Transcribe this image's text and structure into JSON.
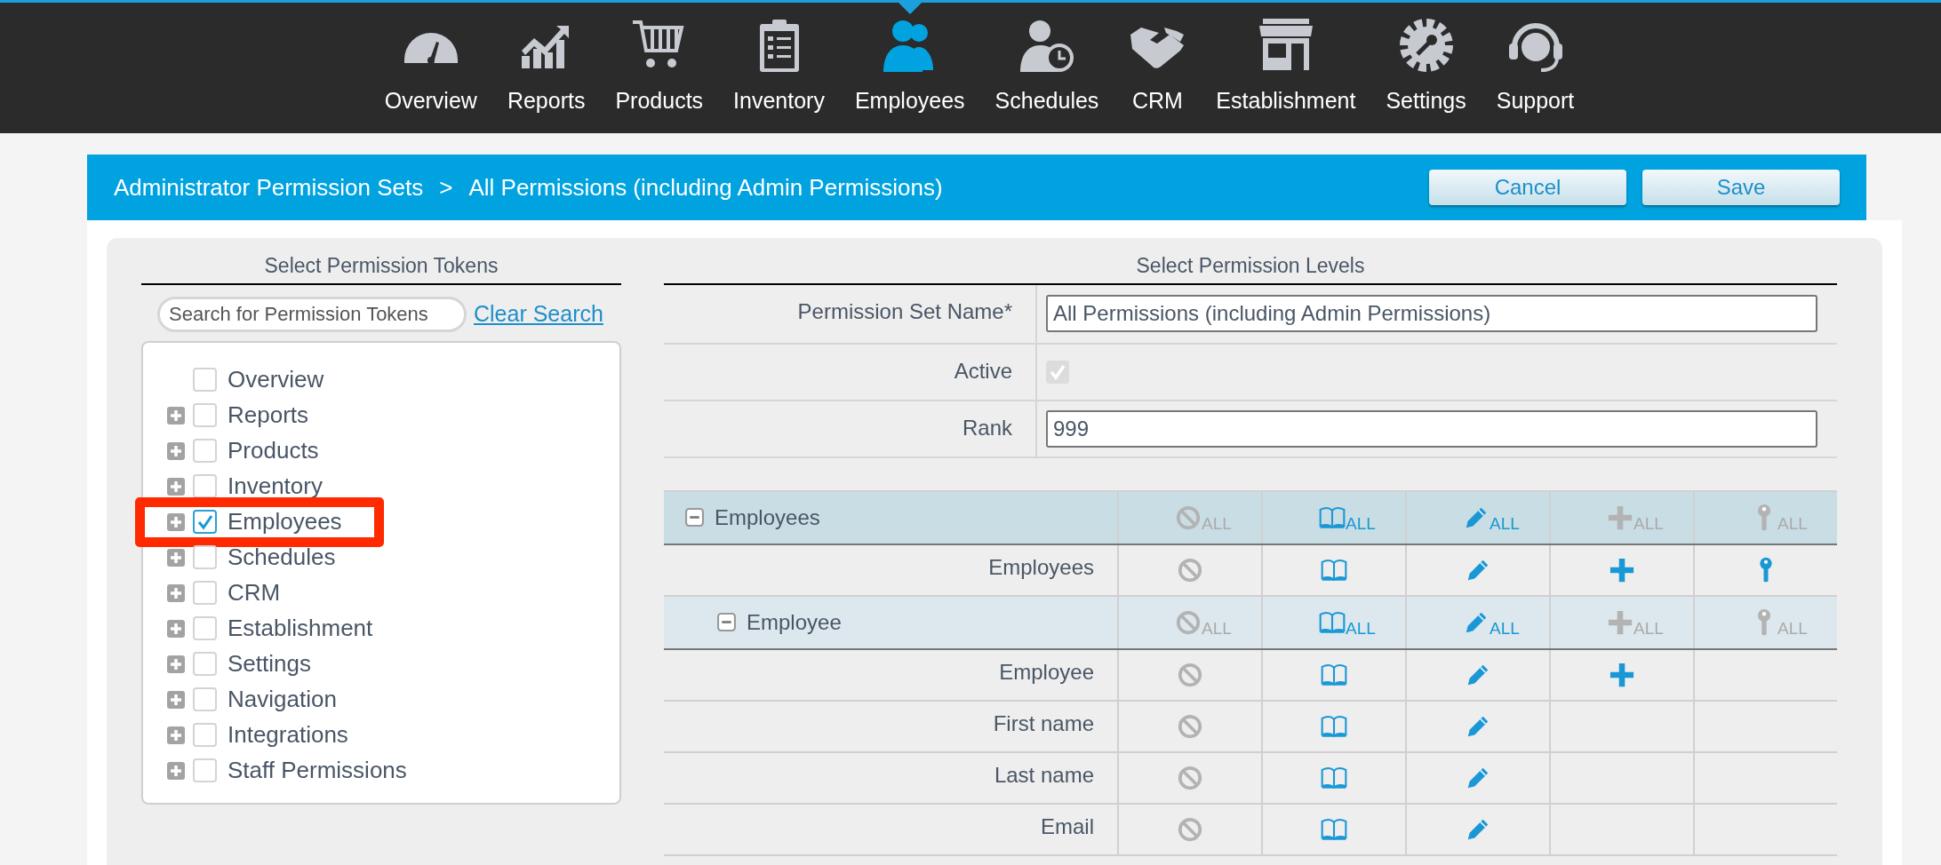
{
  "nav": [
    {
      "label": "Overview",
      "selected": false
    },
    {
      "label": "Reports",
      "selected": false
    },
    {
      "label": "Products",
      "selected": false
    },
    {
      "label": "Inventory",
      "selected": false
    },
    {
      "label": "Employees",
      "selected": true
    },
    {
      "label": "Schedules",
      "selected": false
    },
    {
      "label": "CRM",
      "selected": false
    },
    {
      "label": "Establishment",
      "selected": false
    },
    {
      "label": "Settings",
      "selected": false
    },
    {
      "label": "Support",
      "selected": false
    }
  ],
  "header": {
    "breadcrumb": [
      "Administrator Permission Sets",
      "All Permissions (including Admin Permissions)"
    ],
    "separator": ">",
    "buttons": [
      "Cancel",
      "Save"
    ]
  },
  "tokens": {
    "heading": "Select Permission Tokens",
    "search": {
      "placeholder": "Search for Permission Tokens"
    },
    "clear_link": "Clear Search",
    "tree": [
      {
        "label": "Overview",
        "checked": false,
        "expandable": false
      },
      {
        "label": "Reports",
        "checked": false,
        "expandable": true
      },
      {
        "label": "Products",
        "checked": false,
        "expandable": true
      },
      {
        "label": "Inventory",
        "checked": false,
        "expandable": true
      },
      {
        "label": "Employees",
        "checked": true,
        "expandable": true,
        "highlighted": true
      },
      {
        "label": "Schedules",
        "checked": false,
        "expandable": true
      },
      {
        "label": "CRM",
        "checked": false,
        "expandable": true
      },
      {
        "label": "Establishment",
        "checked": false,
        "expandable": true
      },
      {
        "label": "Settings",
        "checked": false,
        "expandable": true
      },
      {
        "label": "Navigation",
        "checked": false,
        "expandable": true
      },
      {
        "label": "Integrations",
        "checked": false,
        "expandable": true
      },
      {
        "label": "Staff Permissions",
        "checked": false,
        "expandable": true
      }
    ]
  },
  "levels": {
    "heading": "Select Permission Levels",
    "fields": [
      {
        "label": "Permission Set Name*",
        "kind": "text",
        "value": "All Permissions (including Admin Permissions)"
      },
      {
        "label": "Active",
        "kind": "checkbox",
        "checked": true,
        "disabled": true
      },
      {
        "label": "Rank",
        "kind": "text",
        "value": "999"
      }
    ],
    "table": [
      {
        "kind": "group",
        "label": "Employees",
        "expanded": true,
        "perms": [
          {
            "kind": "none",
            "label": "ALL",
            "active": false
          },
          {
            "kind": "read",
            "label": "ALL",
            "active": true
          },
          {
            "kind": "edit",
            "label": "ALL",
            "active": true
          },
          {
            "kind": "add",
            "label": "ALL",
            "active": false
          },
          {
            "kind": "key",
            "label": "ALL",
            "active": false
          }
        ],
        "children": [
          {
            "kind": "row",
            "label": "Employees",
            "perms": [
              {
                "kind": "none",
                "active": false
              },
              {
                "kind": "read",
                "active": true
              },
              {
                "kind": "edit",
                "active": true
              },
              {
                "kind": "add",
                "active": true
              },
              {
                "kind": "key",
                "active": true
              }
            ]
          },
          {
            "kind": "group",
            "label": "Employee",
            "expanded": true,
            "perms": [
              {
                "kind": "none",
                "label": "ALL",
                "active": false
              },
              {
                "kind": "read",
                "label": "ALL",
                "active": true
              },
              {
                "kind": "edit",
                "label": "ALL",
                "active": true
              },
              {
                "kind": "add",
                "label": "ALL",
                "active": false
              },
              {
                "kind": "key",
                "label": "ALL",
                "active": false
              }
            ],
            "children": [
              {
                "kind": "row",
                "label": "Employee",
                "perms": [
                  {
                    "kind": "none",
                    "active": false
                  },
                  {
                    "kind": "read",
                    "active": true
                  },
                  {
                    "kind": "edit",
                    "active": true
                  },
                  {
                    "kind": "add",
                    "active": true
                  },
                  {
                    "kind": "blank"
                  }
                ]
              },
              {
                "kind": "row",
                "label": "First name",
                "perms": [
                  {
                    "kind": "none",
                    "active": false
                  },
                  {
                    "kind": "read",
                    "active": true
                  },
                  {
                    "kind": "edit",
                    "active": true
                  },
                  {
                    "kind": "blank"
                  },
                  {
                    "kind": "blank"
                  }
                ]
              },
              {
                "kind": "row",
                "label": "Last name",
                "perms": [
                  {
                    "kind": "none",
                    "active": false
                  },
                  {
                    "kind": "read",
                    "active": true
                  },
                  {
                    "kind": "edit",
                    "active": true
                  },
                  {
                    "kind": "blank"
                  },
                  {
                    "kind": "blank"
                  }
                ]
              },
              {
                "kind": "row",
                "label": "Email",
                "perms": [
                  {
                    "kind": "none",
                    "active": false
                  },
                  {
                    "kind": "read",
                    "active": true
                  },
                  {
                    "kind": "edit",
                    "active": true
                  },
                  {
                    "kind": "blank"
                  },
                  {
                    "kind": "blank"
                  }
                ]
              }
            ]
          }
        ]
      }
    ]
  }
}
